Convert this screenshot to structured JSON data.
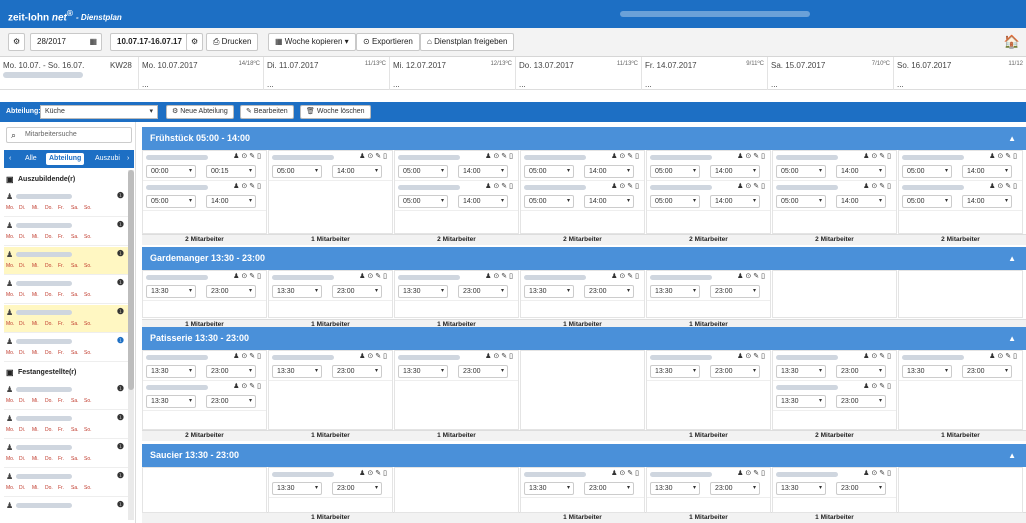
{
  "app": {
    "name": "zeit-lohn",
    "net": "net",
    "reg": "®",
    "subtitle": "- Dienstplan"
  },
  "toolbar": {
    "week_input": "28/2017",
    "range": "10.07.17-16.07.17",
    "print": "Drucken",
    "copy_week": "Woche kopieren",
    "export": "Exportieren",
    "release": "Dienstplan freigeben"
  },
  "days_header": {
    "week_range": "Mo. 10.07. - So. 16.07.",
    "kw": "KW28",
    "days": [
      {
        "label": "Mo. 10.07.2017",
        "weather": "14/18ºC"
      },
      {
        "label": "Di. 11.07.2017",
        "weather": "11/13ºC"
      },
      {
        "label": "Mi. 12.07.2017",
        "weather": "12/13ºC"
      },
      {
        "label": "Do. 13.07.2017",
        "weather": "11/13ºC"
      },
      {
        "label": "Fr. 14.07.2017",
        "weather": "9/11ºC"
      },
      {
        "label": "Sa. 15.07.2017",
        "weather": "7/10ºC"
      },
      {
        "label": "So. 16.07.2017",
        "weather": "11/12"
      }
    ],
    "dots": "..."
  },
  "deptbar": {
    "label": "Abteilung:",
    "value": "Küche",
    "new_dept": "Neue Abteilung",
    "edit": "Bearbeiten",
    "delete_week": "Woche löschen"
  },
  "sidebar": {
    "search_placeholder": "Mitarbeitersuche",
    "tabs": [
      "Alle",
      "Abteilung",
      "Auszubi"
    ],
    "groups": [
      "Auszubildende(r)",
      "Festangestellte(r)"
    ],
    "weekdays": [
      "Mo.",
      "Di.",
      "Mi.",
      "Do.",
      "Fr.",
      "Sa.",
      "So."
    ]
  },
  "shift_sections": [
    {
      "title": "Frühstück 05:00 - 14:00"
    },
    {
      "title": "Gardemanger 13:30 - 23:00"
    },
    {
      "title": "Patisserie 13:30 - 23:00"
    },
    {
      "title": "Saucier 13:30 - 23:00"
    }
  ],
  "times": {
    "f_a": "00:00",
    "f_b": "00:15",
    "f_s": "05:00",
    "f_e": "14:00",
    "g_s": "13:30",
    "g_e": "23:00"
  },
  "counts": {
    "two": "2 Mitarbeiter",
    "one": "1 Mitarbeiter"
  },
  "icons": {
    "search": "search-icon",
    "home": "home-icon",
    "info": "info-icon",
    "user": "user-icon",
    "trash": "trash-icon",
    "pencil": "pencil-icon",
    "clock": "clock-icon"
  },
  "colors": {
    "brand": "#1d6fc4",
    "section": "#4a90d9"
  }
}
